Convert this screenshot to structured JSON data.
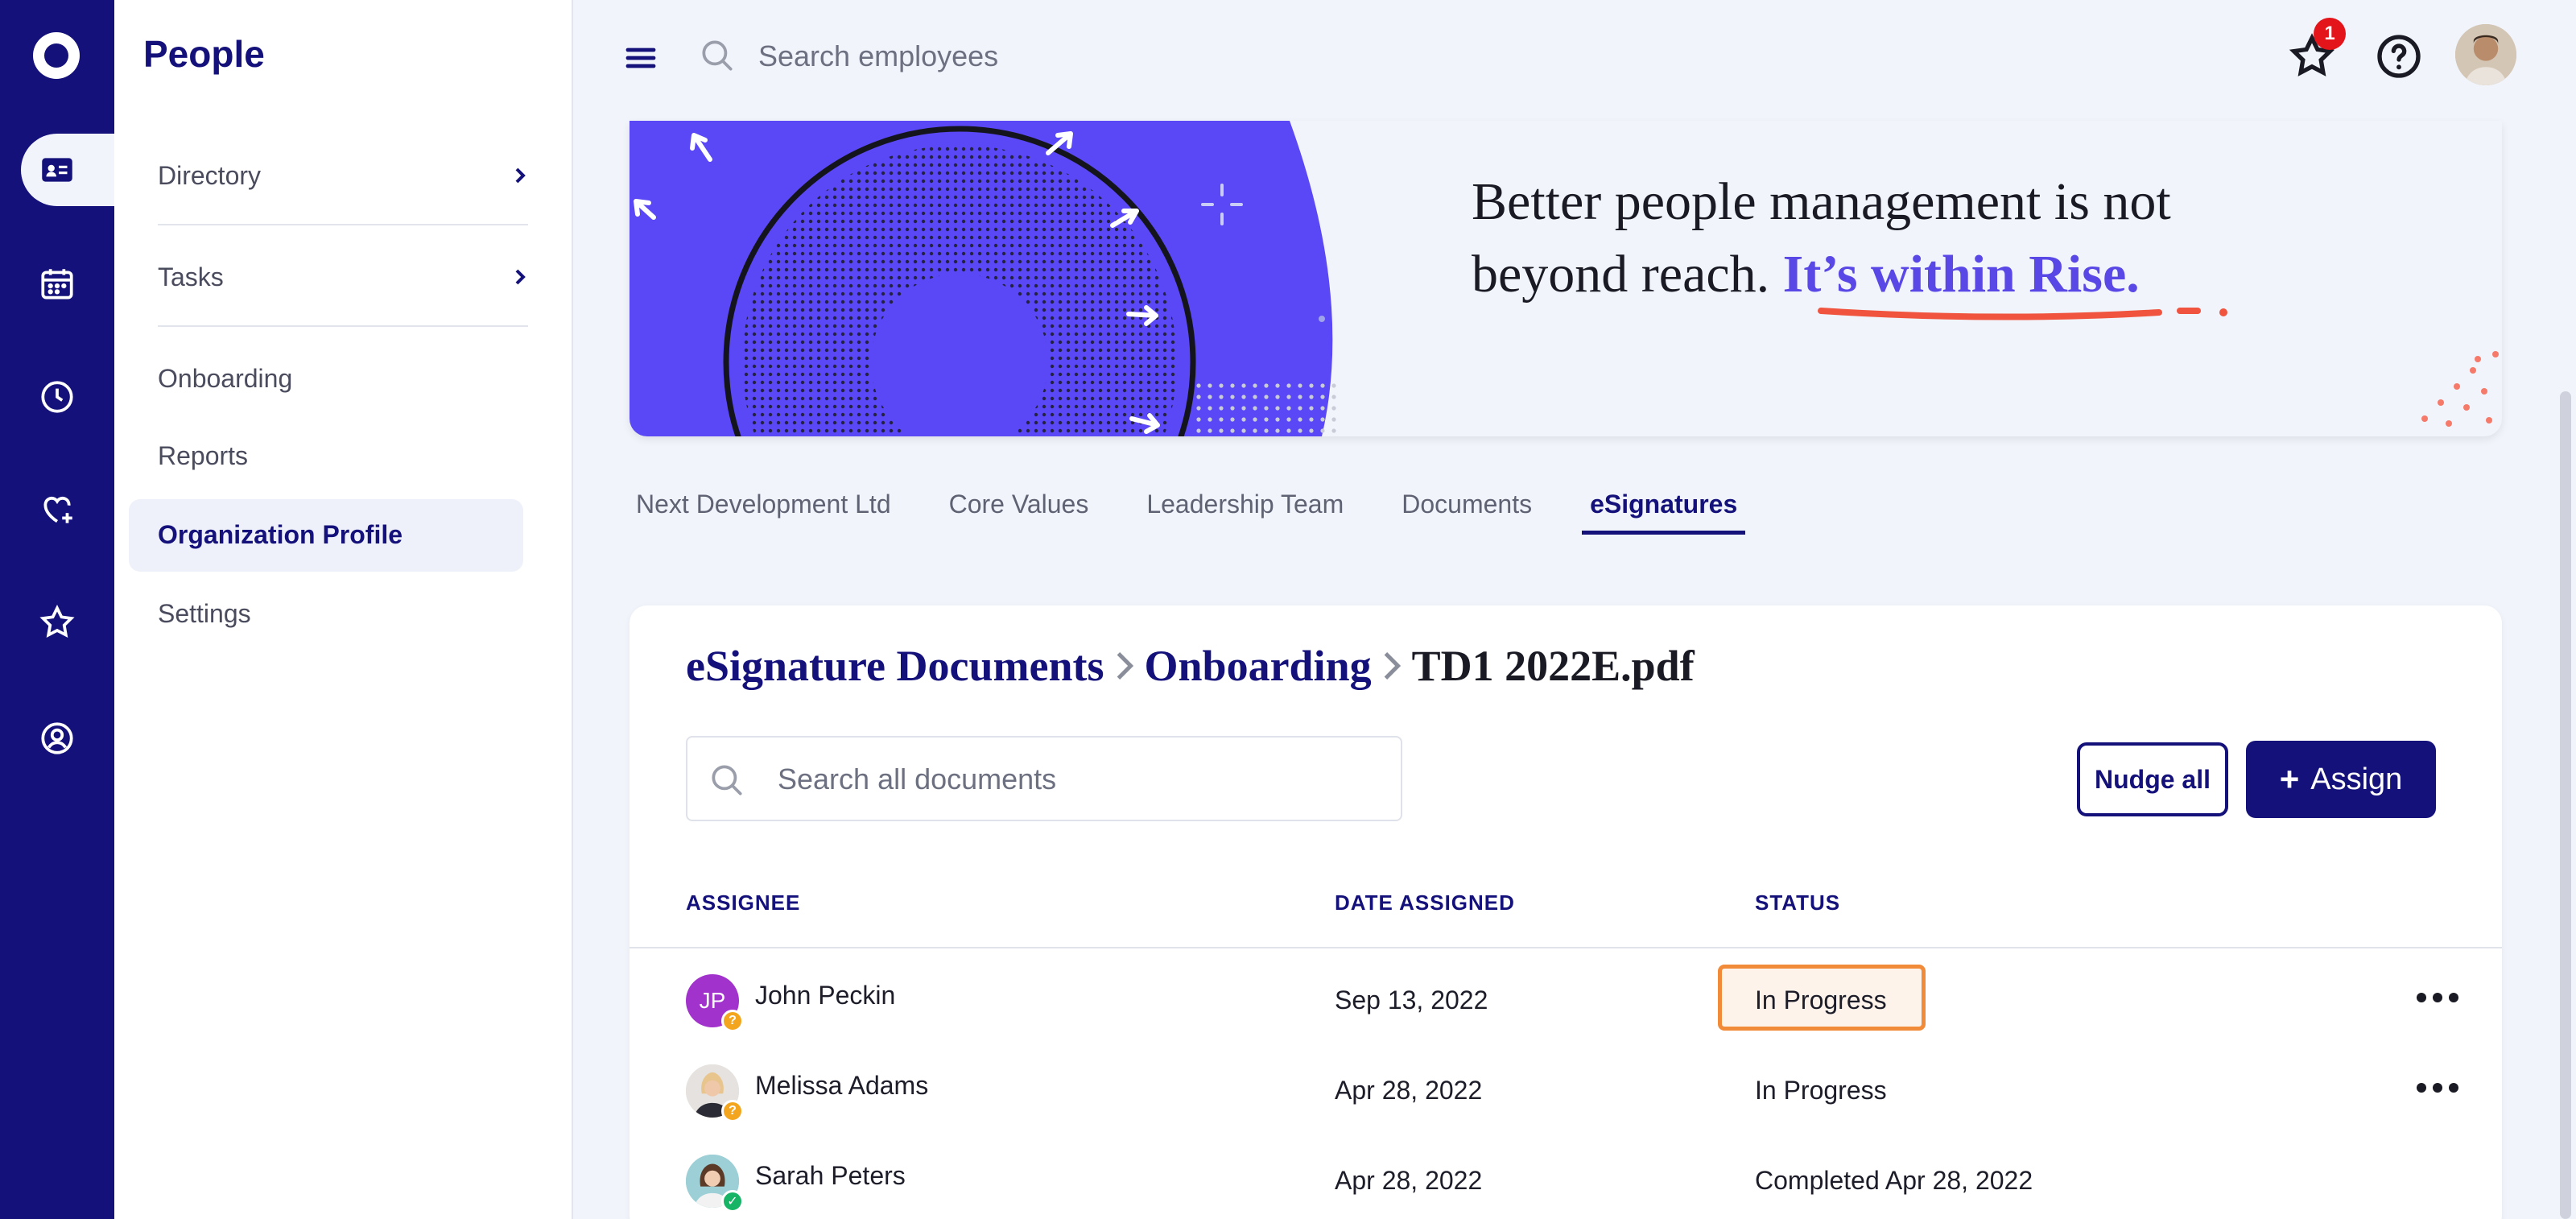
{
  "app": {
    "section_title": "People"
  },
  "sidebar": {
    "items": [
      {
        "label": "Directory",
        "has_chevron": true
      },
      {
        "label": "Tasks",
        "has_chevron": true
      },
      {
        "label": "Onboarding"
      },
      {
        "label": "Reports"
      },
      {
        "label": "Organization Profile",
        "active": true
      },
      {
        "label": "Settings"
      }
    ]
  },
  "topbar": {
    "search_placeholder": "Search employees",
    "notification_count": "1"
  },
  "banner": {
    "line1": "Better people management is not",
    "line2_prefix": "beyond reach.",
    "line2_accent": "It’s within Rise."
  },
  "tabs": [
    {
      "label": "Next Development Ltd"
    },
    {
      "label": "Core Values"
    },
    {
      "label": "Leadership Team"
    },
    {
      "label": "Documents"
    },
    {
      "label": "eSignatures",
      "active": true
    }
  ],
  "documents": {
    "breadcrumb": [
      "eSignature Documents",
      "Onboarding",
      "TD1 2022E.pdf"
    ],
    "search_placeholder": "Search all documents",
    "nudge_label": "Nudge all",
    "assign_label": "Assign",
    "columns": [
      "ASSIGNEE",
      "DATE ASSIGNED",
      "STATUS"
    ],
    "rows": [
      {
        "initials": "JP",
        "name": "John Peckin",
        "date": "Sep 13, 2022",
        "status": "In Progress"
      },
      {
        "name": "Melissa Adams",
        "date": "Apr 28, 2022",
        "status": "In Progress"
      },
      {
        "name": "Sarah Peters",
        "date": "Apr 28, 2022",
        "status": "Completed Apr 28, 2022"
      }
    ]
  },
  "colors": {
    "brand": "#14127a",
    "accent": "#5a48e6",
    "highlight": "#f28b39"
  }
}
